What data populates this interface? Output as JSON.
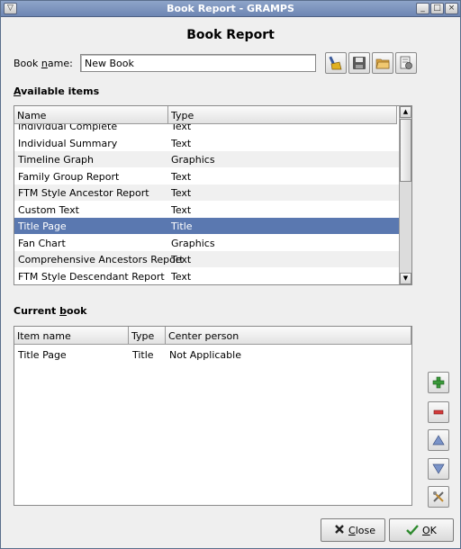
{
  "window": {
    "title": "Book Report - GRAMPS",
    "heading": "Book Report"
  },
  "book_name": {
    "label_pre": "Book ",
    "label_accel": "n",
    "label_post": "ame:",
    "value": "New Book"
  },
  "toolbar": {
    "buttons": [
      "clear-icon",
      "save-icon",
      "open-icon",
      "edit-books-icon"
    ]
  },
  "available": {
    "label_accel": "A",
    "label_post": "vailable items",
    "columns": [
      "Name",
      "Type"
    ],
    "partial_row": {
      "name": "Individual Complete",
      "type": "Text"
    },
    "rows": [
      {
        "name": "Individual Summary",
        "type": "Text"
      },
      {
        "name": "Timeline Graph",
        "type": "Graphics"
      },
      {
        "name": "Family Group Report",
        "type": "Text"
      },
      {
        "name": "FTM Style Ancestor Report",
        "type": "Text"
      },
      {
        "name": "Custom Text",
        "type": "Text"
      },
      {
        "name": "Title Page",
        "type": "Title"
      },
      {
        "name": "Fan Chart",
        "type": "Graphics"
      },
      {
        "name": "Comprehensive Ancestors Report",
        "type": "Text"
      },
      {
        "name": "FTM Style Descendant Report",
        "type": "Text"
      }
    ],
    "selected_index": 5
  },
  "current": {
    "label_pre": "Current ",
    "label_accel": "b",
    "label_post": "ook",
    "columns": [
      "Item name",
      "Type",
      "Center person"
    ],
    "rows": [
      {
        "name": "Title Page",
        "type": "Title",
        "center": "Not Applicable"
      }
    ]
  },
  "side_buttons": [
    "add-icon",
    "remove-icon",
    "up-icon",
    "down-icon",
    "configure-icon"
  ],
  "buttons": {
    "close_accel": "C",
    "close_post": "lose",
    "ok_accel": "O",
    "ok_post": "K"
  },
  "colors": {
    "selection": "#5a78b0",
    "titlebar": "#6d86b3"
  }
}
